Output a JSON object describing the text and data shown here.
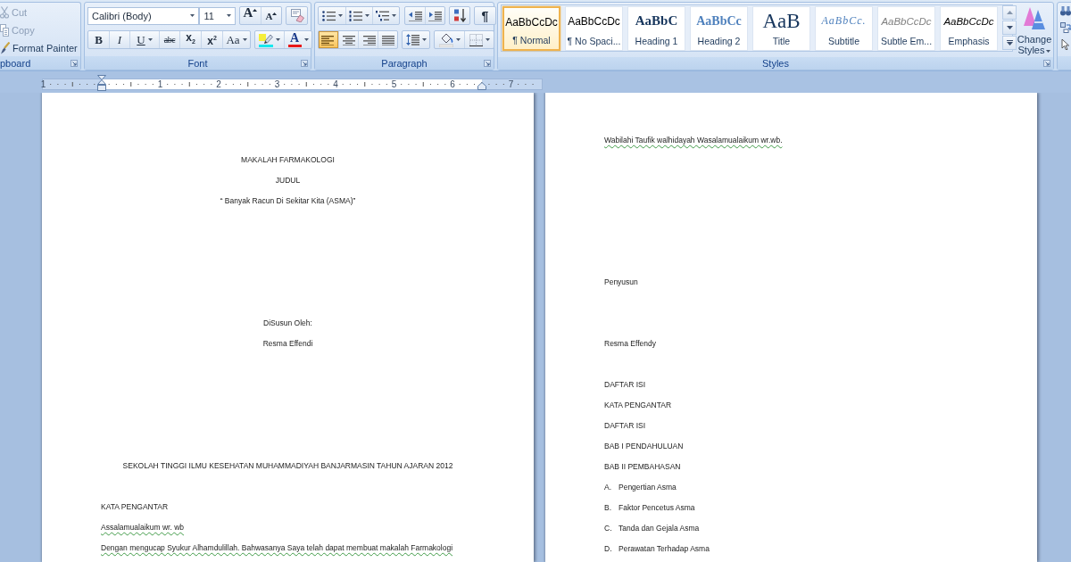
{
  "ribbon": {
    "clipboard": {
      "label": "pboard",
      "items": [
        {
          "label": "Cut",
          "disabled": true
        },
        {
          "label": "Copy",
          "disabled": true
        },
        {
          "label": "Format Painter",
          "disabled": false
        }
      ]
    },
    "font": {
      "label": "Font",
      "font_name": "Calibri (Body)",
      "font_size": "11",
      "size_buttons": [
        {
          "kind": "grow",
          "label": "A"
        },
        {
          "kind": "shrink",
          "label": "A"
        }
      ],
      "format_buttons": [
        {
          "kind": "bold",
          "label": "B"
        },
        {
          "kind": "italic",
          "label": "I"
        },
        {
          "kind": "underline",
          "label": "U"
        },
        {
          "kind": "strike",
          "label": "abc"
        },
        {
          "kind": "subscript",
          "label": "x$_{2}$"
        },
        {
          "kind": "superscript",
          "label": "x$^{2}$"
        },
        {
          "kind": "case",
          "label": "Aa"
        }
      ],
      "font_color": "A"
    },
    "paragraph": {
      "label": "Paragraph",
      "marks_button": "¶",
      "align_buttons": [
        {
          "selected": true
        },
        {
          "selected": false
        },
        {
          "selected": false
        },
        {
          "selected": false
        }
      ]
    },
    "styles": {
      "label": "Styles",
      "items": [
        {
          "kind": "normal",
          "preview": "AaBbCcDc",
          "name": "¶ Normal",
          "selected": true
        },
        {
          "kind": "no_spacing",
          "preview": "AaBbCcDc",
          "name": "¶ No Spaci...",
          "selected": false
        },
        {
          "kind": "heading_1",
          "preview": "AaBbC",
          "name": "Heading 1",
          "selected": false
        },
        {
          "kind": "heading_2",
          "preview": "AaBbCc",
          "name": "Heading 2",
          "selected": false
        },
        {
          "kind": "title",
          "preview": "AaB",
          "name": "Title",
          "selected": false
        },
        {
          "kind": "subtitle",
          "preview": "AaBbCc.",
          "name": "Subtitle",
          "selected": false
        },
        {
          "kind": "subtle_emphasis",
          "preview": "AaBbCcDc",
          "name": "Subtle Em...",
          "selected": false
        },
        {
          "kind": "emphasis",
          "preview": "AaBbCcDc",
          "name": "Emphasis",
          "selected": false
        }
      ],
      "change_styles": "Change Styles"
    }
  },
  "ruler": {
    "labels": [
      "1",
      "1",
      "2",
      "3",
      "4",
      "5",
      "6",
      "7"
    ]
  },
  "document": {
    "pages": [
      {
        "sections": [
          {
            "kind": "cover_title",
            "lines": [
              {
                "text": "MAKALAH FARMAKOLOGI",
                "squiggle": false
              },
              {
                "text": "JUDUL",
                "squiggle": false
              },
              {
                "text": "“ Banyak Racun Di Sekitar Kita (ASMA)”",
                "squiggle": false
              }
            ]
          },
          {
            "kind": "byline",
            "lines": [
              {
                "text": "DiSusun Oleh:",
                "squiggle": false
              },
              {
                "text": "Resma Effendi",
                "squiggle": false
              }
            ]
          },
          {
            "kind": "institution",
            "lines": [
              {
                "text": "SEKOLAH TINGGI ILMU KESEHATAN MUHAMMADIYAH BANJARMASIN TAHUN AJARAN 2012",
                "squiggle": false
              }
            ]
          },
          {
            "kind": "preface",
            "lines": [
              {
                "text": "KATA PENGANTAR",
                "squiggle": false
              },
              {
                "text": "Assalamualaikum wr. wb",
                "squiggle": true
              },
              {
                "text": "Dengan mengucap Syukur Alhamdulillah. Bahwasanya Saya telah dapat membuat makalah Farmakologi",
                "squiggle": true
              }
            ]
          }
        ]
      },
      {
        "sections": [
          {
            "kind": "closing",
            "lines": [
              {
                "text": "Wabilahi Taufik walhidayah Wasalamualaikum wr.wb.",
                "squiggle": true
              }
            ]
          },
          {
            "kind": "signature",
            "lines": [
              {
                "text": "Penyusun",
                "squiggle": false
              }
            ]
          },
          {
            "kind": "signer",
            "lines": [
              {
                "text": "Resma Effendy",
                "squiggle": false
              }
            ]
          },
          {
            "kind": "toc",
            "lines": [
              {
                "text": "DAFTAR ISI",
                "squiggle": false
              },
              {
                "text": "KATA PENGANTAR",
                "squiggle": false
              },
              {
                "text": "DAFTAR ISI",
                "squiggle": false
              },
              {
                "text": "BAB I PENDAHULUAN",
                "squiggle": false
              },
              {
                "text": "BAB II PEMBAHASAN",
                "squiggle": false
              },
              {
                "marker": "A.",
                "text": "Pengertian Asma",
                "squiggle": false
              },
              {
                "marker": "B.",
                "text": "Faktor Pencetus Asma",
                "squiggle": false
              },
              {
                "marker": "C.",
                "text": "Tanda dan Gejala Asma",
                "squiggle": false
              },
              {
                "marker": "D.",
                "text": "Perawatan Terhadap Asma",
                "squiggle": false
              }
            ]
          }
        ]
      }
    ]
  }
}
